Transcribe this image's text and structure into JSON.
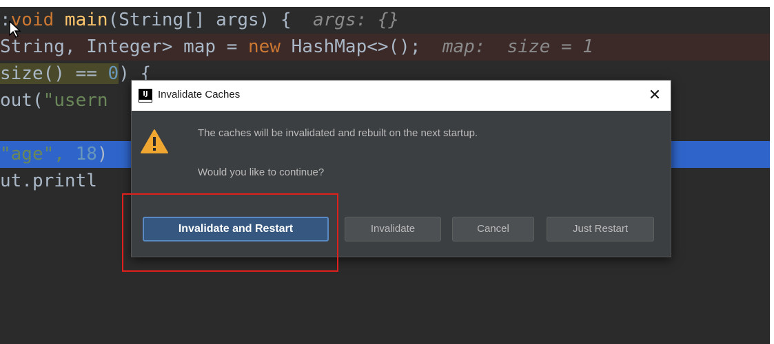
{
  "code": {
    "line1": {
      "prefix": ":",
      "kw_void": "void",
      "fn_main": " main",
      "sig": "(String[] args) {  ",
      "hint": "args: {}"
    },
    "line2": {
      "text": "String, Integer> map = ",
      "kw_new": "new",
      "rest": " HashMap<>();  ",
      "hint": "map:  size = 1"
    },
    "line3": {
      "text": "size() == ",
      "num": "0",
      "rest": ") {"
    },
    "line4": {
      "text": "out(",
      "str": "\"usern"
    },
    "line6": {
      "str": "\"age\", ",
      "num": "18",
      "rest": ")"
    },
    "line7": {
      "text": "ut.printl"
    }
  },
  "dialog": {
    "title": "Invalidate Caches",
    "app_icon_text": "IJ",
    "close_glyph": "✕",
    "message_1": "The caches will be invalidated and rebuilt on the next startup.",
    "message_2": "Would you like to continue?",
    "buttons": {
      "invalidate_restart": "Invalidate and Restart",
      "invalidate": "Invalidate",
      "cancel": "Cancel",
      "just_restart": "Just Restart"
    }
  },
  "icons": {
    "warning": "warning-icon",
    "cursor": "mouse-pointer-icon",
    "close": "close-icon",
    "app": "intellij-icon"
  },
  "colors": {
    "editor_bg": "#2b2b2b",
    "dialog_bg": "#3c3f41",
    "primary_button": "#365880",
    "highlight_box": "#e0201d",
    "warning": "#f0a732",
    "selection": "#2f65ca"
  }
}
